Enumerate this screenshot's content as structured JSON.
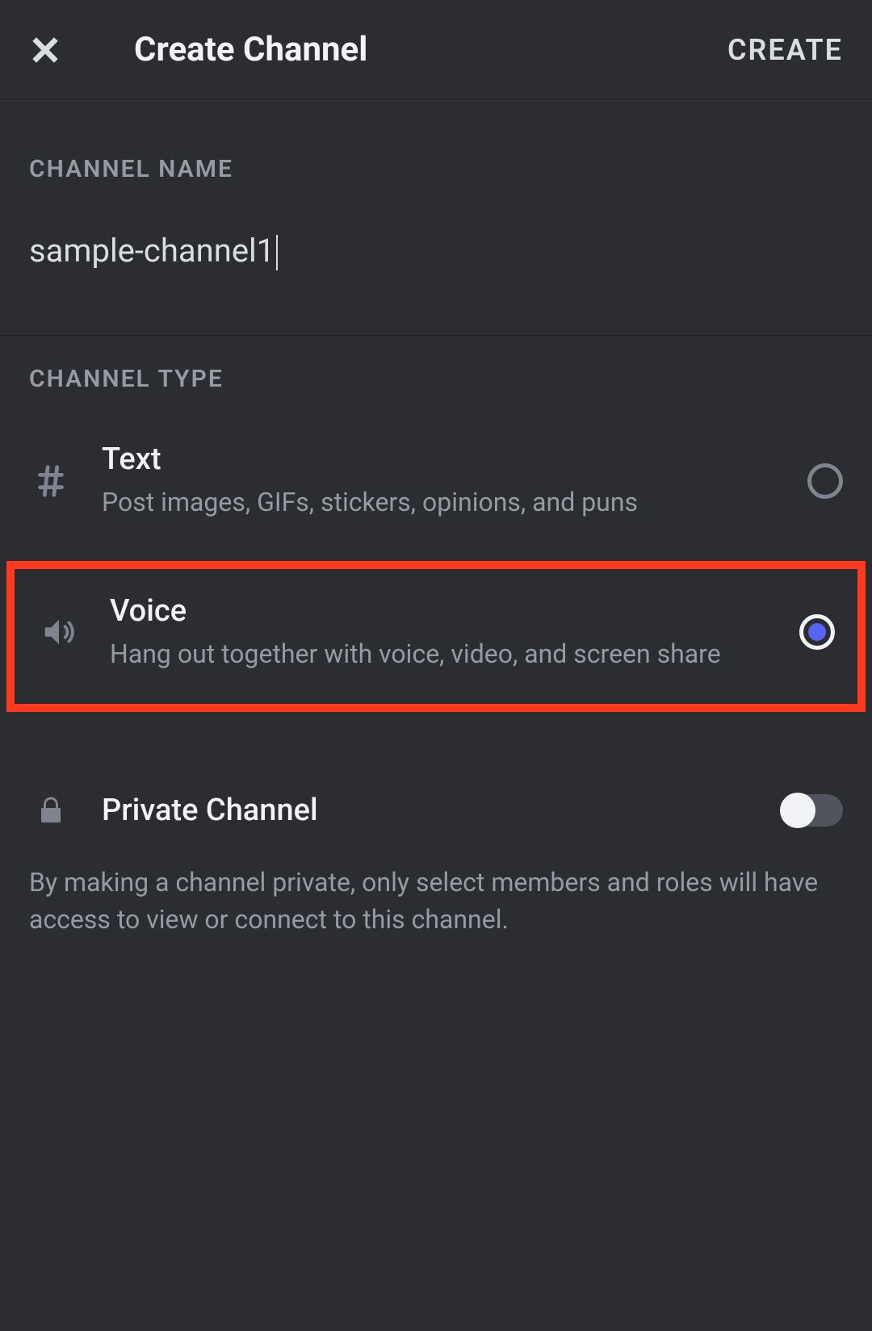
{
  "header": {
    "title": "Create Channel",
    "create_label": "CREATE"
  },
  "channel_name": {
    "label": "CHANNEL NAME",
    "value": "sample-channel1"
  },
  "channel_type": {
    "label": "CHANNEL TYPE",
    "options": [
      {
        "title": "Text",
        "desc": "Post images, GIFs, stickers, opinions, and puns",
        "selected": false
      },
      {
        "title": "Voice",
        "desc": "Hang out together with voice, video, and screen share",
        "selected": true
      }
    ]
  },
  "private": {
    "label": "Private Channel",
    "enabled": false,
    "desc": "By making a channel private, only select members and roles will have access to view or connect to this channel."
  }
}
